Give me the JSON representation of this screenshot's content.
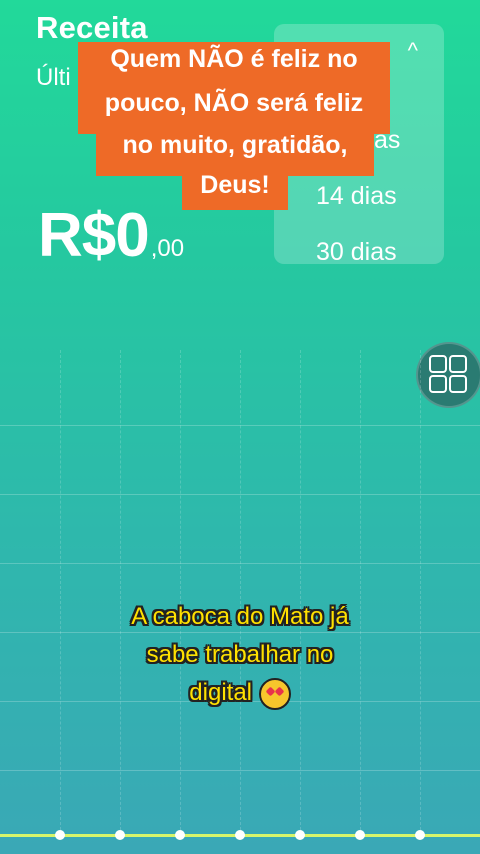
{
  "header": {
    "title": "Receita",
    "subtitle": "Últi"
  },
  "amount": {
    "main": "R$0",
    "cents": ",00"
  },
  "period_dropdown": {
    "partial_option": "as",
    "options": [
      "14 dias",
      "30 dias"
    ],
    "caret": "^"
  },
  "overlay": {
    "text_lines": [
      "Quem NÃO é feliz no",
      "pouco,  NÃO será feliz",
      "no muito, gratidão,",
      "Deus!"
    ]
  },
  "caption": {
    "lines": [
      "A caboca do Mato já",
      "sabe trabalhar no",
      "digital"
    ],
    "emoji": "star-struck-emoji"
  },
  "icons": {
    "grid": "grid-icon"
  },
  "colors": {
    "background_top": "#22d99a",
    "background_bottom": "#3aa8b6",
    "overlay_box": "#ee6a27",
    "caption_text": "#ffe100",
    "axis": "#d7f56b"
  }
}
